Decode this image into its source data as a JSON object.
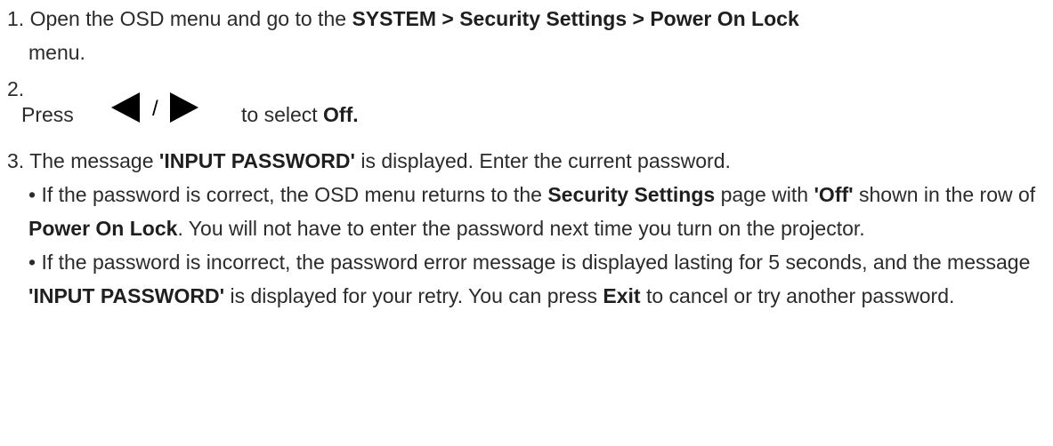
{
  "step1": {
    "number": "1.",
    "text_a": "Open the OSD menu and go to the",
    "path": "SYSTEM > Security Settings > Power On Lock",
    "text_b": "menu."
  },
  "step2": {
    "number": "2.",
    "text_a": "Press",
    "left_arrow_icon": "left-triangle-icon",
    "slash": "/",
    "right_arrow_icon": "right-triangle-icon",
    "text_b": "to select",
    "option": "Off."
  },
  "step3": {
    "number": "3.",
    "text_a": "The message",
    "message": "'INPUT PASSWORD'",
    "text_b": "is displayed. Enter the current password.",
    "bullet1": {
      "text_a": "• If the password is correct, the OSD menu returns to the",
      "page": "Security Settings",
      "text_b": "page with",
      "value": "'Off'",
      "text_c": "shown in the row of",
      "row": "Power On Lock",
      "text_d": ". You will not have to enter the password next time you turn on the projector."
    },
    "bullet2": {
      "text_a": "• If the password is incorrect, the password error message is displayed lasting for 5 seconds, and the message",
      "message": "'INPUT PASSWORD'",
      "text_b": "is displayed for your retry. You can press",
      "key": "Exit",
      "text_c": "to cancel or try another password."
    }
  }
}
